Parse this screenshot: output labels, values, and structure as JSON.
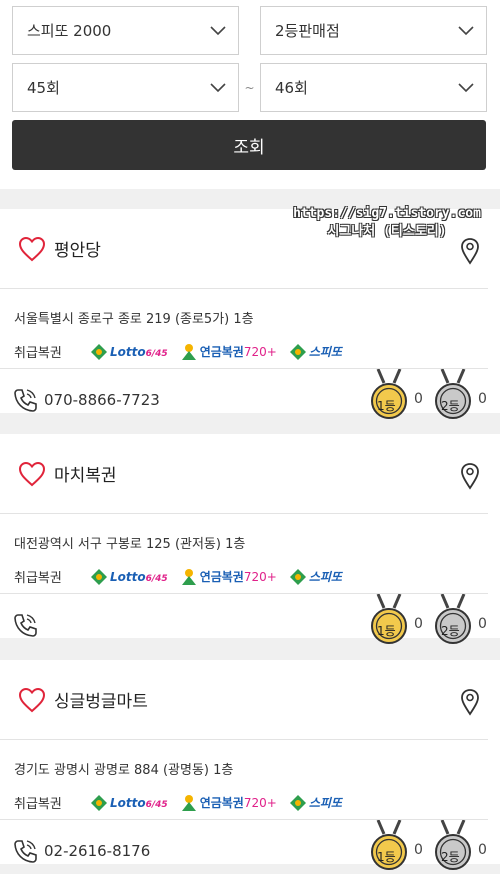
{
  "filters": {
    "game": "스피또 2000",
    "rank": "2등판매점",
    "round_from": "45회",
    "round_to": "46회",
    "range_sep": "~",
    "search_label": "조회"
  },
  "kinds_label": "취급복권",
  "logos": {
    "lotto_main": "Lotto",
    "lotto_sub": "6/45",
    "pension_main": "연금복권",
    "pension_sub": "720+",
    "speetto": "스피또"
  },
  "stores": [
    {
      "name": "평안당",
      "address": "서울특별시 종로구 종로 219 (종로5가) 1층",
      "phone": "070-8866-7723",
      "first_count": "0",
      "second_count": "0"
    },
    {
      "name": "마치복권",
      "address": "대전광역시 서구 구봉로 125 (관저동) 1층",
      "phone": "",
      "first_count": "0",
      "second_count": "0"
    },
    {
      "name": "싱글벙글마트",
      "address": "경기도 광명시 광명로 884 (광명동) 1층",
      "phone": "02-2616-8176",
      "first_count": "0",
      "second_count": "0"
    }
  ],
  "medal_labels": {
    "first": "1등",
    "second": "2등"
  },
  "watermark": {
    "line1": "https://sig7.tistory.com",
    "line2": "시그나처 (티스토리)"
  },
  "colors": {
    "button_bg": "#333333",
    "gold": "#f2c94c",
    "silver": "#c9c9c9",
    "heart": "#e0243a"
  }
}
